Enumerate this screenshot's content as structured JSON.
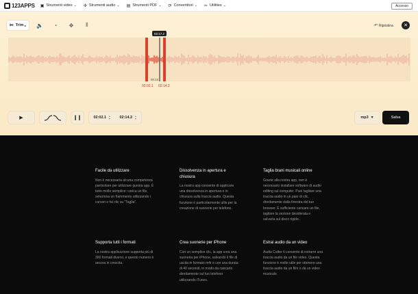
{
  "nav": {
    "logo": "123APPS",
    "items": [
      {
        "label": "Strumenti video",
        "icon": "video-icon"
      },
      {
        "label": "Strumenti audio",
        "icon": "audio-icon"
      },
      {
        "label": "Strumenti PDF",
        "icon": "pdf-icon"
      },
      {
        "label": "Convertitori",
        "icon": "convert-icon"
      },
      {
        "label": "Utilities",
        "icon": "tools-icon"
      }
    ],
    "login": "Accesso"
  },
  "editor": {
    "trim_label": "Trim",
    "restore_label": "Ripristina",
    "playhead_time": "02:17.2",
    "cursor_time": "00:10",
    "start_handle_time": "02:02.1",
    "end_handle_time": "02:14.2",
    "selection_color": "#d9402d"
  },
  "controls": {
    "start_time": "02:02.1",
    "end_time": "02:14.2",
    "format": "mp3",
    "save_label": "Salva"
  },
  "features": [
    {
      "title": "Facile da utilizzare",
      "text": "Non è necessaria alcuna competenza particolare per utilizzare questa app. È tutto molto semplice: carica un file, seleziona un frammento utilizzando i cursori e fai clic su \"Taglia\"."
    },
    {
      "title": "Dissolvenza in apertura e chiusura",
      "text": "La nostra app consente di applicare una dissolvenza in apertura e in chiusura sulla traccia audio. Questa funzione è particolarmente utile per la creazione di suonerie per telefono."
    },
    {
      "title": "Taglia brani musicali online",
      "text": "Grazie alla nostra app, non è necessario installare software di audio editing sul computer. Puoi tagliare una traccia audio in un paio di clic, direttamente dalla finestra del tuo browser. È sufficiente caricare un file, tagliare la sezione desiderata e salvarla sul disco rigido."
    },
    {
      "title": "Supporta tutti i formati",
      "text": "La nostra applicazione supporta più di 300 formati diversi, e questo numero è ancora in crescita."
    },
    {
      "title": "Crea suonerie per iPhone",
      "text": "Con un semplice clic, la app crea una suoneria per iPhone, salvando il file di uscita in formato m4r e con una durata di 40 secondi, in modo da caricarlo direttamente sul tuo telefono utilizzando iTunes."
    },
    {
      "title": "Estrai audio da un video",
      "text": "Audio Cutter ti consente di estrarre una traccia audio da un file video. Questa funzione è molto utile per ottenere una traccia audio da un film o da un video musicale."
    }
  ]
}
